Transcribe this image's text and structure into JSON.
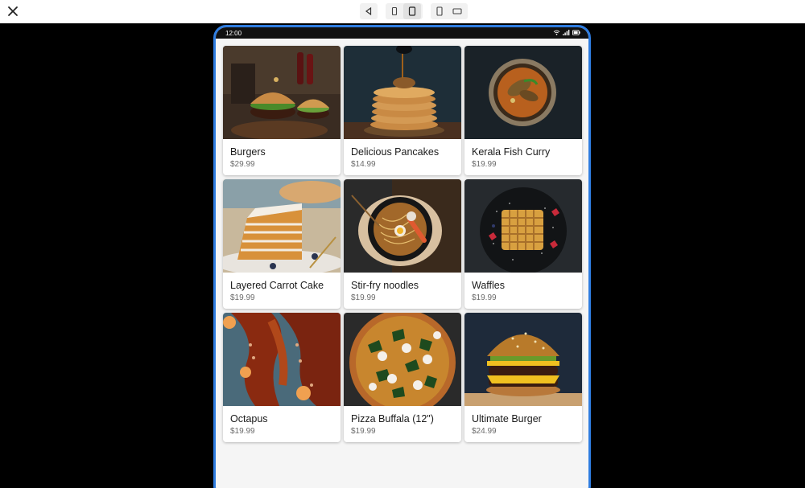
{
  "toolbar": {
    "close_icon": "close-icon",
    "buttons": [
      {
        "icon": "back-triangle-icon"
      },
      {
        "icon": "phone-small-icon"
      },
      {
        "icon": "phone-large-icon"
      },
      {
        "icon": "tablet-portrait-icon"
      },
      {
        "icon": "tablet-landscape-icon"
      }
    ]
  },
  "statusbar": {
    "time": "12:00",
    "icons": [
      "wifi-icon",
      "signal-icon",
      "battery-icon"
    ]
  },
  "colors": {
    "frame_accent": "#2f7de0",
    "card_bg": "#ffffff",
    "page_bg": "#f5f5f5"
  },
  "menu": {
    "items": [
      {
        "name": "Burgers",
        "price": "$29.99",
        "image": "burgers"
      },
      {
        "name": "Delicious Pancakes",
        "price": "$14.99",
        "image": "pancakes"
      },
      {
        "name": "Kerala Fish Curry",
        "price": "$19.99",
        "image": "fish-curry"
      },
      {
        "name": "Layered Carrot Cake",
        "price": "$19.99",
        "image": "carrot-cake"
      },
      {
        "name": "Stir-fry noodles",
        "price": "$19.99",
        "image": "noodles"
      },
      {
        "name": "Waffles",
        "price": "$19.99",
        "image": "waffles"
      },
      {
        "name": "Octapus",
        "price": "$19.99",
        "image": "octopus"
      },
      {
        "name": "Pizza Buffala (12\")",
        "price": "$19.99",
        "image": "pizza"
      },
      {
        "name": "Ultimate Burger",
        "price": "$24.99",
        "image": "ultimate-burger"
      }
    ]
  }
}
